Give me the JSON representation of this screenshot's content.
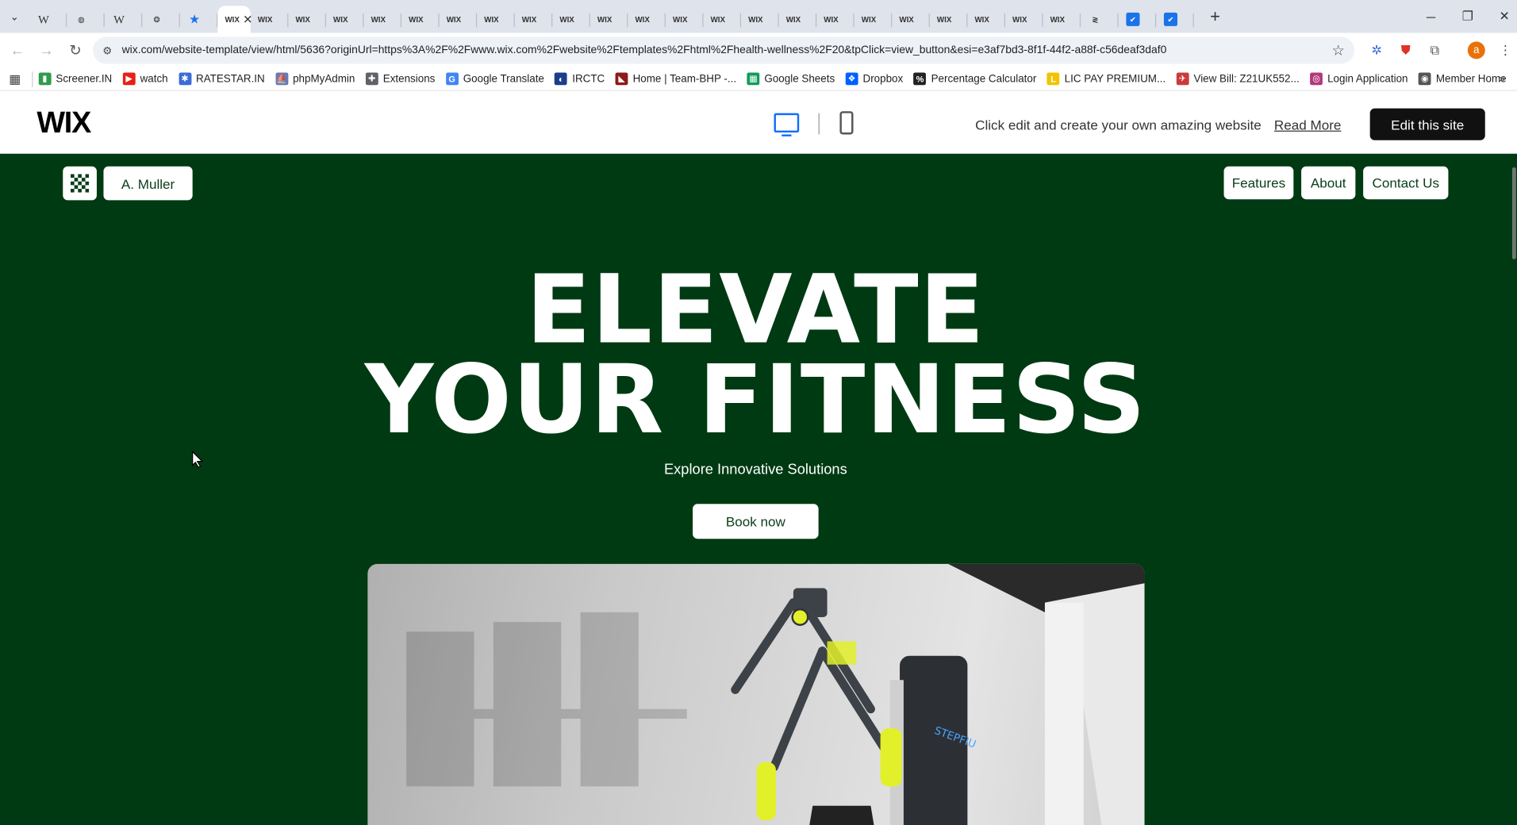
{
  "tabs": {
    "items": [
      {
        "icon": "wiki-icon",
        "glyph": "W"
      },
      {
        "icon": "un-icon",
        "glyph": "◍"
      },
      {
        "icon": "wiki-icon",
        "glyph": "W"
      },
      {
        "icon": "openai-icon",
        "glyph": "❂"
      },
      {
        "icon": "star-icon",
        "glyph": "★"
      },
      {
        "icon": "wix-icon",
        "glyph": "WIX"
      },
      {
        "icon": "wix-icon",
        "glyph": "WIX"
      },
      {
        "icon": "wix-icon",
        "glyph": "WIX"
      },
      {
        "icon": "wix-icon",
        "glyph": "WIX"
      },
      {
        "icon": "wix-icon",
        "glyph": "WIX"
      },
      {
        "icon": "wix-icon",
        "glyph": "WIX"
      },
      {
        "icon": "wix-icon",
        "glyph": "WIX"
      },
      {
        "icon": "wix-icon",
        "glyph": "WIX"
      },
      {
        "icon": "wix-icon",
        "glyph": "WIX"
      },
      {
        "icon": "wix-icon",
        "glyph": "WIX"
      },
      {
        "icon": "wix-icon",
        "glyph": "WIX"
      },
      {
        "icon": "wix-icon",
        "glyph": "WIX"
      },
      {
        "icon": "wix-icon",
        "glyph": "WIX"
      },
      {
        "icon": "wix-icon",
        "glyph": "WIX"
      },
      {
        "icon": "wix-icon",
        "glyph": "WIX"
      },
      {
        "icon": "wix-icon",
        "glyph": "WIX"
      },
      {
        "icon": "wix-icon",
        "glyph": "WIX"
      },
      {
        "icon": "wix-icon",
        "glyph": "WIX"
      },
      {
        "icon": "wix-icon",
        "glyph": "WIX"
      },
      {
        "icon": "wix-icon",
        "glyph": "WIX"
      },
      {
        "icon": "wix-icon",
        "glyph": "WIX"
      },
      {
        "icon": "wix-icon",
        "glyph": "WIX"
      },
      {
        "icon": "wix-icon",
        "glyph": "WIX"
      },
      {
        "icon": "kite-icon",
        "glyph": "≷"
      },
      {
        "icon": "blue-app-icon",
        "glyph": "✔"
      },
      {
        "icon": "blue-app-icon",
        "glyph": "✔"
      }
    ],
    "active_index": 5
  },
  "address_bar": {
    "url": "wix.com/website-template/view/html/5636?originUrl=https%3A%2F%2Fwww.wix.com%2Fwebsite%2Ftemplates%2Fhtml%2Fhealth-wellness%2F20&tpClick=view_button&esi=e3af7bd3-8f1f-44f2-a88f-c56deaf3daf0",
    "profile_initial": "a"
  },
  "bookmarks": [
    {
      "label": "Screener.IN",
      "color": "#2e9c4a",
      "icon": "screener-icon",
      "glyph": "▮"
    },
    {
      "label": "watch",
      "color": "#e62117",
      "icon": "youtube-icon",
      "glyph": "▶"
    },
    {
      "label": "RATESTAR.IN",
      "color": "#3b6bd6",
      "icon": "ratestar-icon",
      "glyph": "✱"
    },
    {
      "label": "phpMyAdmin",
      "color": "#6c78af",
      "icon": "phpmyadmin-icon",
      "glyph": "⛵"
    },
    {
      "label": "Extensions",
      "color": "#5f6368",
      "icon": "puzzle-icon",
      "glyph": "✚"
    },
    {
      "label": "Google Translate",
      "color": "#4285f4",
      "icon": "translate-icon",
      "glyph": "G"
    },
    {
      "label": "IRCTC",
      "color": "#1a3e8a",
      "icon": "irctc-icon",
      "glyph": "◐"
    },
    {
      "label": "Home | Team-BHP -...",
      "color": "#8b1a1a",
      "icon": "teambhp-icon",
      "glyph": "◣"
    },
    {
      "label": "Google Sheets",
      "color": "#0f9d58",
      "icon": "sheets-icon",
      "glyph": "▦"
    },
    {
      "label": "Dropbox",
      "color": "#0061ff",
      "icon": "dropbox-icon",
      "glyph": "❖"
    },
    {
      "label": "Percentage Calculator",
      "color": "#222222",
      "icon": "percent-icon",
      "glyph": "%"
    },
    {
      "label": "LIC PAY PREMIUM...",
      "color": "#f2c300",
      "icon": "lic-icon",
      "glyph": "L"
    },
    {
      "label": "View Bill: Z21UK552...",
      "color": "#c93b3b",
      "icon": "bill-icon",
      "glyph": "✈"
    },
    {
      "label": "Login Application",
      "color": "#b33a7a",
      "icon": "login-icon",
      "glyph": "◎"
    },
    {
      "label": "Member Home",
      "color": "#555555",
      "icon": "globe-icon",
      "glyph": "◉"
    }
  ],
  "wix_bar": {
    "logo": "WIX",
    "promo": "Click edit and create your own amazing website",
    "read_more": "Read More",
    "edit_button": "Edit this site"
  },
  "site": {
    "bg_color": "#003a12",
    "brand": "A. Muller",
    "nav": [
      "Features",
      "About",
      "Contact Us"
    ],
    "headline_line1": "ELEVATE",
    "headline_line2": "YOUR FITNESS",
    "subheading": "Explore Innovative Solutions",
    "cta": "Book now",
    "machine_brand": "STEPFIU"
  }
}
